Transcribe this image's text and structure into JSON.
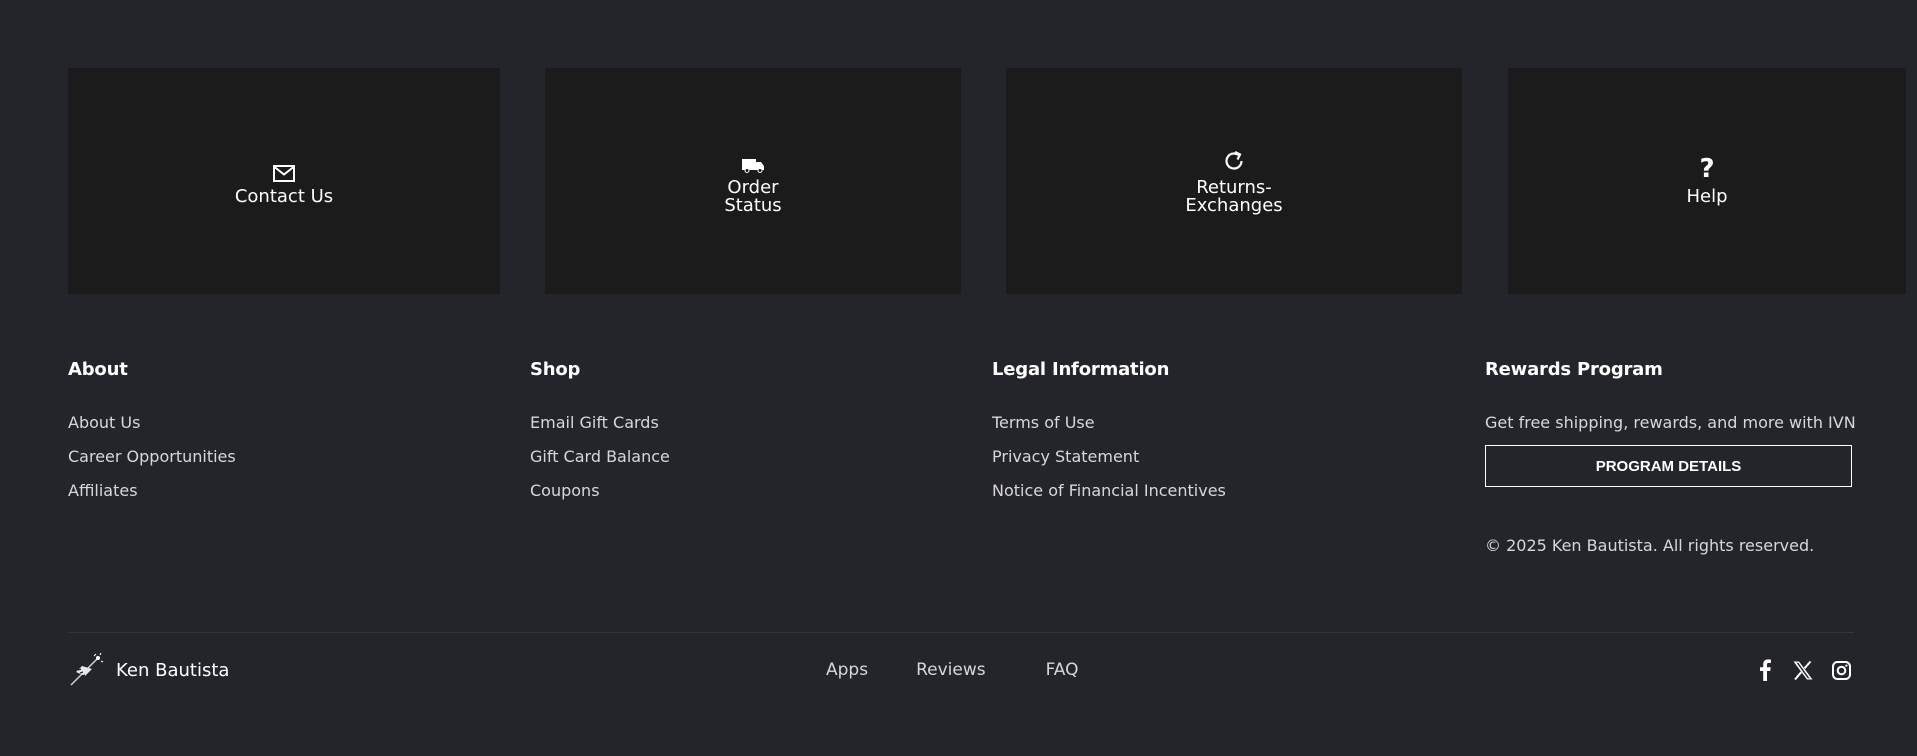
{
  "cards": {
    "contact": {
      "label": "Contact Us",
      "icon": "mail-icon"
    },
    "order": {
      "label": "Order Status",
      "icon": "truck-icon"
    },
    "returns": {
      "label": "Returns-Exchanges",
      "icon": "refresh-icon"
    },
    "help": {
      "label": "Help",
      "icon": "question-icon",
      "glyph": "?"
    }
  },
  "footer": {
    "about": {
      "heading": "About",
      "links": [
        "About Us",
        "Career Opportunities",
        "Affiliates"
      ]
    },
    "shop": {
      "heading": "Shop",
      "links": [
        "Email Gift Cards",
        "Gift Card Balance",
        "Coupons"
      ]
    },
    "legal": {
      "heading": "Legal Information",
      "links": [
        "Terms of Use",
        "Privacy Statement",
        "Notice of Financial Incentives"
      ]
    },
    "rewards": {
      "heading": "Rewards Program",
      "text": "Get free shipping, rewards, and more with IVN",
      "button": "PROGRAM DETAILS",
      "copyright": "© 2025 Ken Bautista. All rights reserved."
    }
  },
  "bottom": {
    "brand": "Ken Bautista",
    "links": [
      "Apps",
      "Reviews",
      "FAQ"
    ],
    "social": [
      "facebook-icon",
      "x-icon",
      "instagram-icon"
    ]
  },
  "colors": {
    "background": "#24252b",
    "card": "#1b1b1b",
    "text": "#ffffff",
    "muted_text": "#d7d7db"
  }
}
